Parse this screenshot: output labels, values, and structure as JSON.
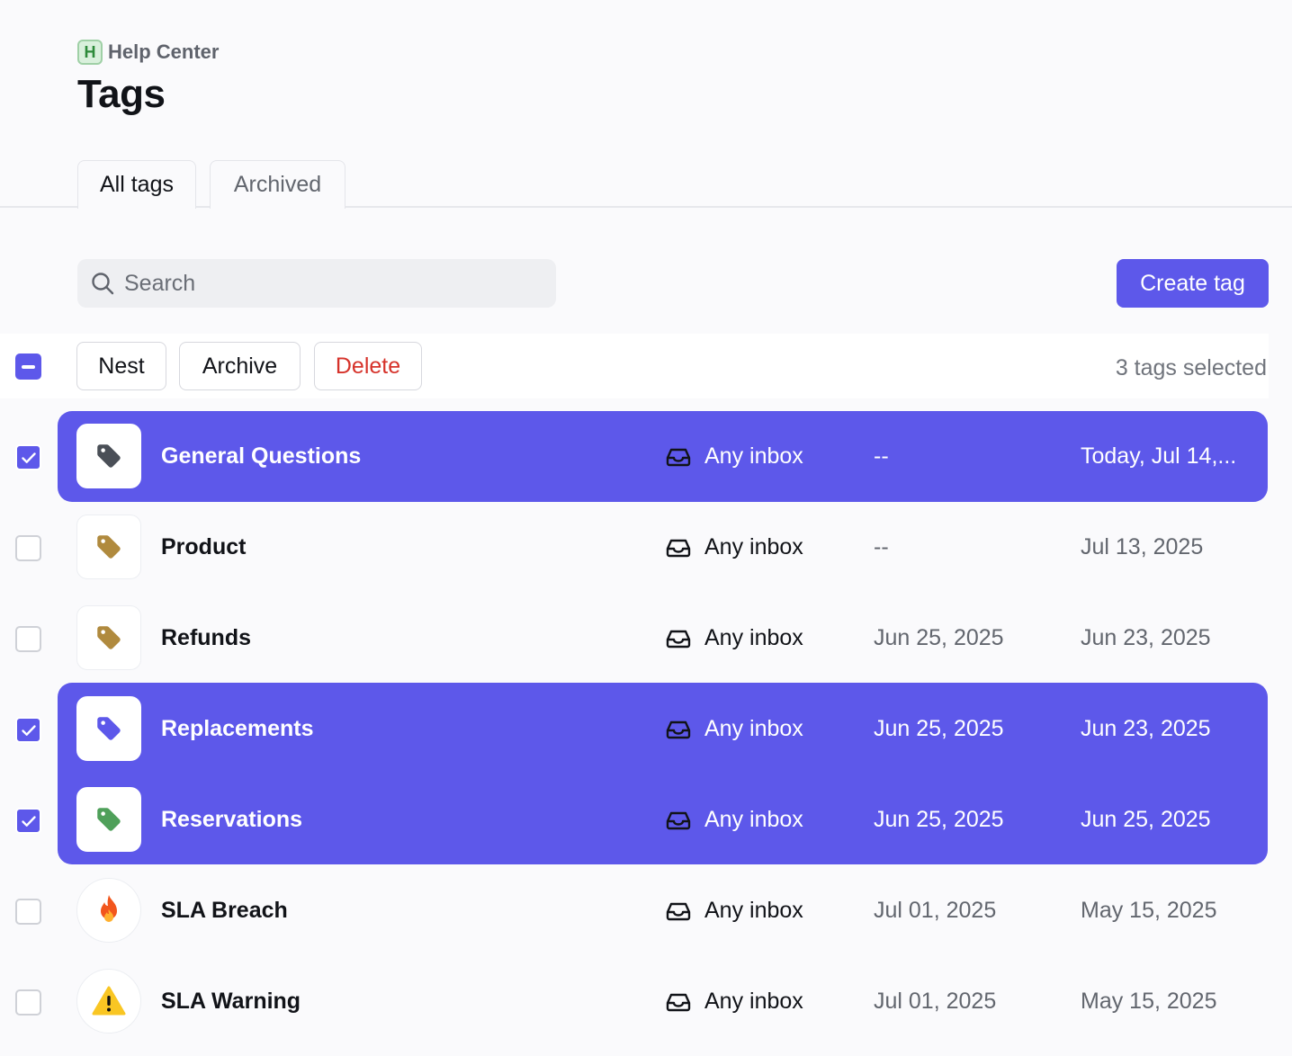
{
  "header": {
    "workspace_badge": "H",
    "workspace_name": "Help Center",
    "title": "Tags"
  },
  "tabs": [
    {
      "label": "All tags",
      "active": true
    },
    {
      "label": "Archived",
      "active": false
    }
  ],
  "search": {
    "placeholder": "Search",
    "value": ""
  },
  "create_button": "Create tag",
  "bulk": {
    "nest_label": "Nest",
    "archive_label": "Archive",
    "delete_label": "Delete",
    "selected_text": "3 tags selected"
  },
  "colors": {
    "accent": "#5d58ea",
    "delete": "#d6322a",
    "tag_gray": "#4a4f57",
    "tag_gold": "#b08a3e",
    "tag_purple": "#5d58ea",
    "tag_green": "#4fa05a"
  },
  "rows": [
    {
      "name": "General Questions",
      "icon": "tag-gray-icon",
      "inbox": "Any inbox",
      "first_used": "--",
      "last_used": "Today, Jul 14,...",
      "selected": true
    },
    {
      "name": "Product",
      "icon": "tag-gold-icon",
      "inbox": "Any inbox",
      "first_used": "--",
      "last_used": "Jul 13, 2025",
      "selected": false
    },
    {
      "name": "Refunds",
      "icon": "tag-gold-icon",
      "inbox": "Any inbox",
      "first_used": "Jun 25, 2025",
      "last_used": "Jun 23, 2025",
      "selected": false
    },
    {
      "name": "Replacements",
      "icon": "tag-purple-icon",
      "inbox": "Any inbox",
      "first_used": "Jun 25, 2025",
      "last_used": "Jun 23, 2025",
      "selected": true
    },
    {
      "name": "Reservations",
      "icon": "tag-green-icon",
      "inbox": "Any inbox",
      "first_used": "Jun 25, 2025",
      "last_used": "Jun 25, 2025",
      "selected": true
    },
    {
      "name": "SLA Breach",
      "icon": "fire-emoji-icon",
      "inbox": "Any inbox",
      "first_used": "Jul 01, 2025",
      "last_used": "May 15, 2025",
      "selected": false
    },
    {
      "name": "SLA Warning",
      "icon": "warning-emoji-icon",
      "inbox": "Any inbox",
      "first_used": "Jul 01, 2025",
      "last_used": "May 15, 2025",
      "selected": false
    }
  ]
}
